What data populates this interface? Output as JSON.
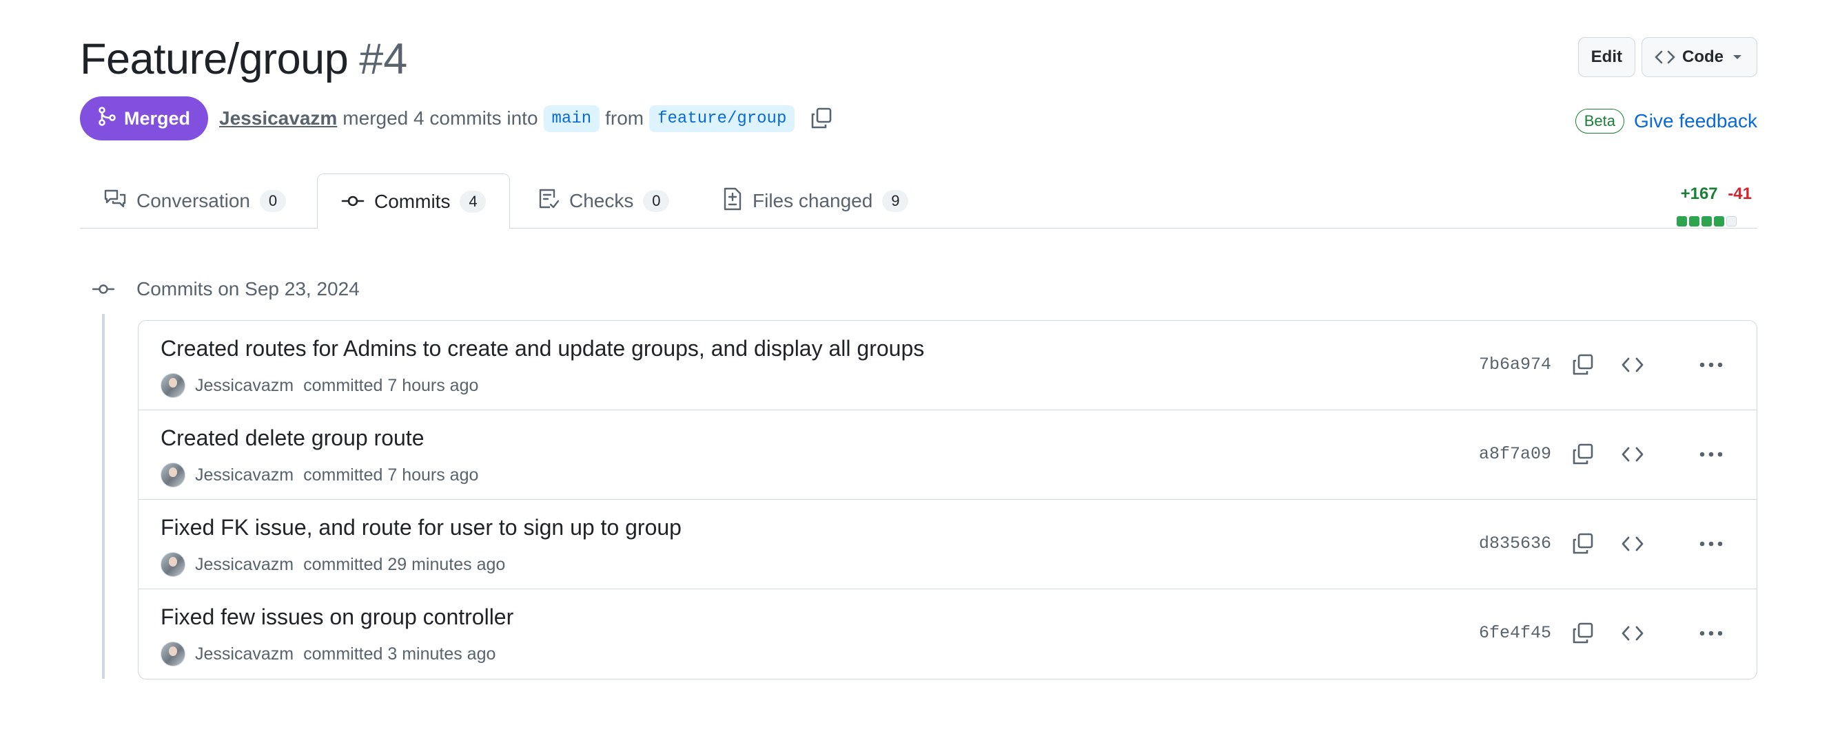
{
  "header": {
    "title": "Feature/group",
    "number": "#4",
    "edit_label": "Edit",
    "code_label": "Code"
  },
  "meta": {
    "status": "Merged",
    "author": "Jessicavazm",
    "merged_text": "merged 4 commits into",
    "base_branch": "main",
    "from_text": "from",
    "head_branch": "feature/group"
  },
  "feedback": {
    "beta": "Beta",
    "link": "Give feedback"
  },
  "tabs": [
    {
      "label": "Conversation",
      "count": "0"
    },
    {
      "label": "Commits",
      "count": "4"
    },
    {
      "label": "Checks",
      "count": "0"
    },
    {
      "label": "Files changed",
      "count": "9"
    }
  ],
  "diffstat": {
    "additions": "+167",
    "deletions": "-41"
  },
  "commits_group": {
    "date_label": "Commits on Sep 23, 2024",
    "commits": [
      {
        "message": "Created routes for Admins to create and update groups, and display all groups",
        "author": "Jessicavazm",
        "time": "committed 7 hours ago",
        "sha": "7b6a974"
      },
      {
        "message": "Created delete group route",
        "author": "Jessicavazm",
        "time": "committed 7 hours ago",
        "sha": "a8f7a09"
      },
      {
        "message": "Fixed FK issue, and route for user to sign up to group",
        "author": "Jessicavazm",
        "time": "committed 29 minutes ago",
        "sha": "d835636"
      },
      {
        "message": "Fixed few issues on group controller",
        "author": "Jessicavazm",
        "time": "committed 3 minutes ago",
        "sha": "6fe4f45"
      }
    ]
  },
  "colors": {
    "merged": "#8250df",
    "link": "#0969da",
    "additions": "#1a7f37",
    "deletions": "#d1242f"
  }
}
